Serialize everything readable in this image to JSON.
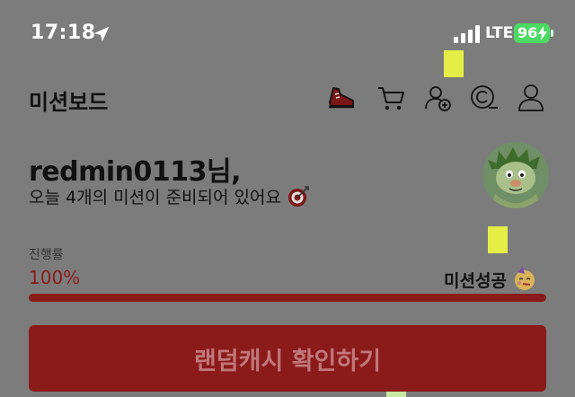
{
  "status_bar": {
    "time": "17:18",
    "network": "LTE",
    "battery": "96"
  },
  "header": {
    "title": "미션보드",
    "icons": [
      "sneaker-icon",
      "cart-icon",
      "add-friend-icon",
      "coin-icon",
      "profile-icon"
    ]
  },
  "profile": {
    "username": "redmin0113님,",
    "subtitle": "오늘 4개의 미션이 준비되어 있어요"
  },
  "progress": {
    "label": "진행률",
    "value_text": "100%",
    "value": 1.0,
    "status": "미션성공"
  },
  "cta": {
    "label": "랜덤캐시 확인하기"
  },
  "colors": {
    "accent": "#8b1a1a",
    "overlay": "#7c7c7c",
    "marker": "#e4ee46"
  }
}
